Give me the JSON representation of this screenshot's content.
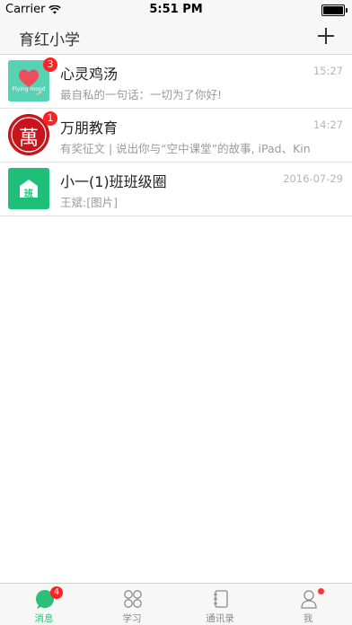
{
  "status_bar": {
    "carrier": "Carrier",
    "time": "5:51 PM"
  },
  "nav": {
    "title": "育红小学"
  },
  "conversations": [
    {
      "avatar_text": "Flying mood",
      "badge": "3",
      "title": "心灵鸡汤",
      "time": "15:27",
      "preview": "最自私的一句话：一切为了你好!"
    },
    {
      "avatar_text": "萬",
      "badge": "1",
      "title": "万朋教育",
      "time": "14:27",
      "preview": "有奖征文 | 说出你与“空中课堂”的故事, iPad、Kin"
    },
    {
      "avatar_text": "班",
      "badge": "",
      "title": "小一(1)班班级圈",
      "time": "2016-07-29",
      "preview": "王斌:[图片]"
    }
  ],
  "tabs": [
    {
      "label": "消息",
      "icon": "message-icon",
      "badge": "4",
      "active": true
    },
    {
      "label": "学习",
      "icon": "grid-icon",
      "active": false
    },
    {
      "label": "通讯录",
      "icon": "contacts-book-icon",
      "active": false
    },
    {
      "label": "我",
      "icon": "person-icon",
      "dot": true,
      "active": false
    }
  ],
  "colors": {
    "accent": "#2bc07a",
    "badge": "#ff2222",
    "soup_bg": "#56d2b4",
    "wanpeng_red": "#c8151b",
    "class_green": "#1fbf7a"
  }
}
